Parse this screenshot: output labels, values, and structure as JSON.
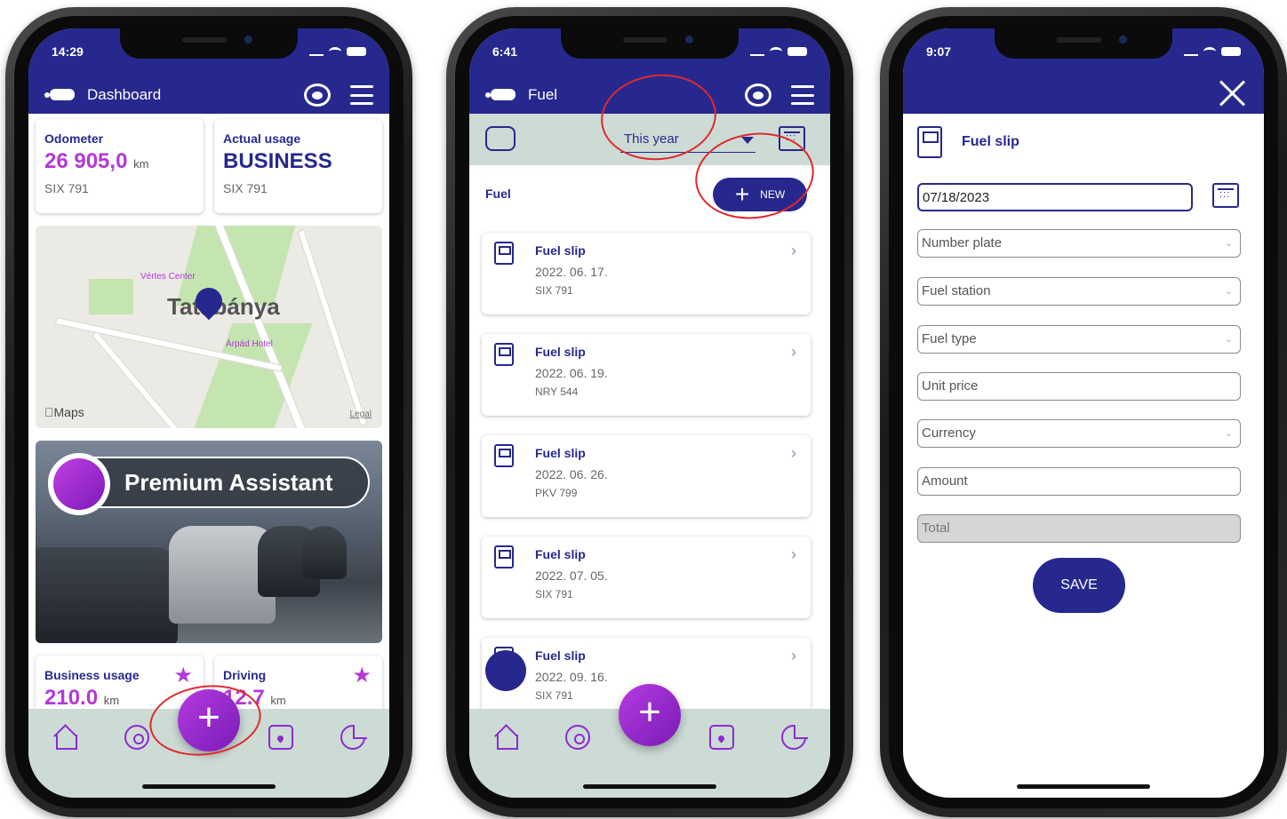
{
  "phone1": {
    "status_time": "14:29",
    "header_title": "Dashboard",
    "odometer": {
      "label": "Odometer",
      "value": "26 905,0",
      "unit": "km",
      "plate": "SIX 791"
    },
    "actual_usage": {
      "label": "Actual usage",
      "value": "BUSINESS",
      "plate": "SIX 791"
    },
    "map": {
      "city": "Tatabánya",
      "poi1": "Vértes Center",
      "poi2": "Árpád Hotel",
      "attribution": "Maps",
      "legal": "Legal"
    },
    "promo_text": "Premium Assistant",
    "business_usage": {
      "label": "Business usage",
      "value": "210.0",
      "unit": "km"
    },
    "driving": {
      "label": "Driving",
      "value": "12.7",
      "unit": "km"
    },
    "fab": "+"
  },
  "phone2": {
    "status_time": "6:41",
    "header_title": "Fuel",
    "filter": "This year",
    "section": "Fuel",
    "new_button": "NEW",
    "slips": [
      {
        "title": "Fuel slip",
        "date": "2022. 06. 17.",
        "plate": "SIX 791"
      },
      {
        "title": "Fuel slip",
        "date": "2022. 06. 19.",
        "plate": "NRY 544"
      },
      {
        "title": "Fuel slip",
        "date": "2022. 06. 26.",
        "plate": "PKV 799"
      },
      {
        "title": "Fuel slip",
        "date": "2022. 07. 05.",
        "plate": "SIX 791"
      },
      {
        "title": "Fuel slip",
        "date": "2022. 09. 16.",
        "plate": "SIX 791"
      }
    ],
    "fab": "+"
  },
  "phone3": {
    "status_time": "9:07",
    "form_title": "Fuel slip",
    "date_value": "07/18/2023",
    "placeholders": {
      "number_plate": "Number plate",
      "fuel_station": "Fuel station",
      "fuel_type": "Fuel type",
      "unit_price": "Unit price",
      "currency": "Currency",
      "amount": "Amount",
      "total": "Total"
    },
    "save": "SAVE"
  },
  "colors": {
    "brand": "#26288e",
    "accent": "#b339d6",
    "nav_bg": "#cddbd5",
    "annotation": "#e0282c"
  }
}
